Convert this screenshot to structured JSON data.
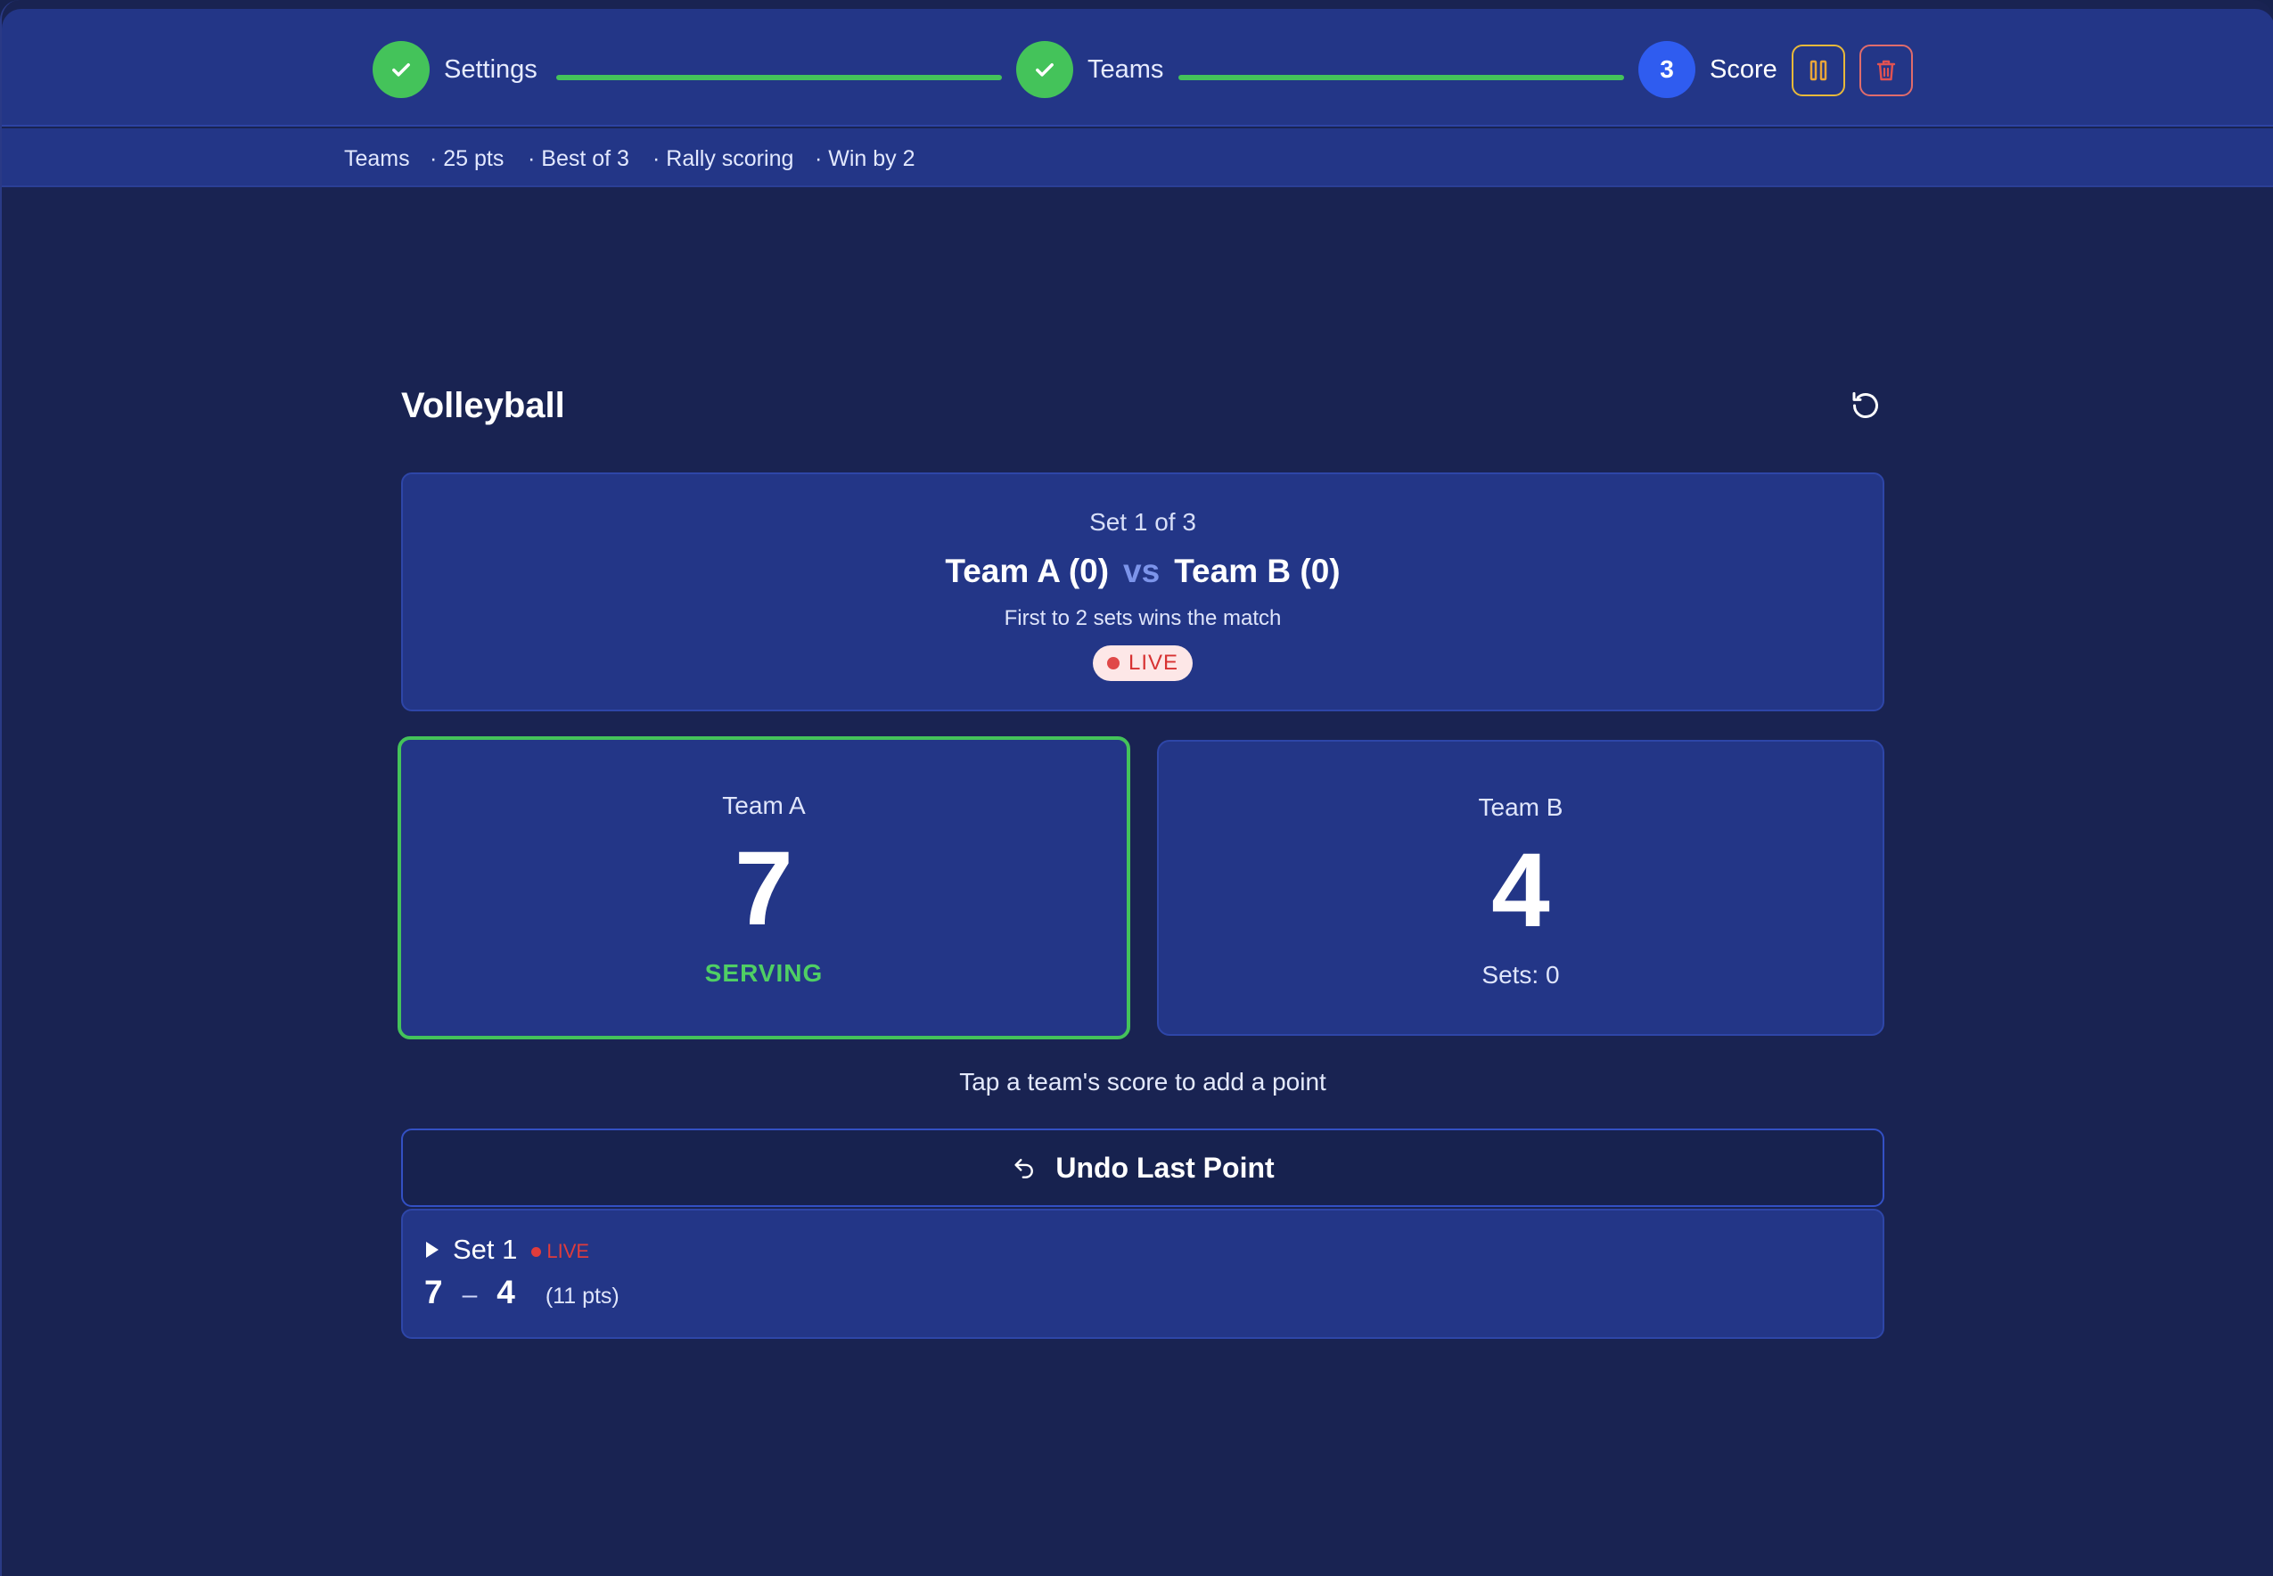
{
  "stepper": {
    "steps": [
      {
        "label": "Settings",
        "status": "done"
      },
      {
        "label": "Teams",
        "status": "done"
      },
      {
        "label": "Score",
        "status": "current",
        "number": "3"
      }
    ]
  },
  "summary": {
    "items": [
      "Teams",
      "· 25 pts",
      "· Best of 3",
      "· Rally scoring",
      "· Win by 2"
    ]
  },
  "page": {
    "title": "Volleyball"
  },
  "match": {
    "set_info": "Set 1 of 3",
    "team_a_label": "Team A (0)",
    "vs": "vs",
    "team_b_label": "Team B (0)",
    "rule": "First to 2 sets wins the match",
    "status": "LIVE"
  },
  "teams": {
    "a": {
      "name": "Team A",
      "score": "7",
      "footer": "SERVING"
    },
    "b": {
      "name": "Team B",
      "score": "4",
      "footer": "Sets: 0"
    }
  },
  "hint": "Tap a team's score to add a point",
  "undo": {
    "label": "Undo Last Point"
  },
  "history": {
    "set_label": "Set 1",
    "status": "LIVE",
    "score_a": "7",
    "dash": "–",
    "score_b": "4",
    "points": "(11 pts)"
  },
  "colors": {
    "background": "#192352",
    "card": "#233687",
    "accent_green": "#44c35a",
    "accent_blue": "#2f5cf0",
    "live_red": "#e04848",
    "pause_yellow": "#e8b93a"
  },
  "icons": {
    "step_done": "check-icon",
    "pause": "pause-icon",
    "delete": "trash-icon",
    "reset": "refresh-icon",
    "undo": "undo-icon",
    "expand": "caret-right-icon"
  }
}
